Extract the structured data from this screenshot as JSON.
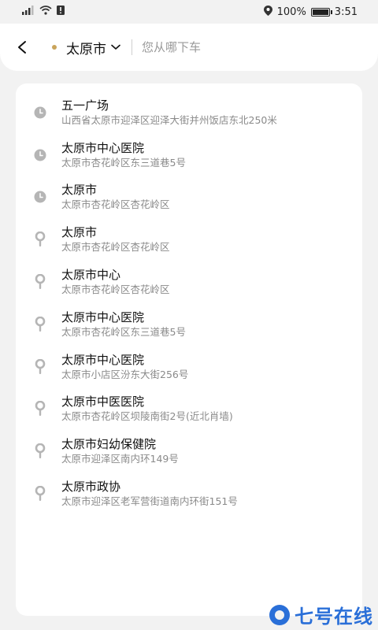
{
  "status_bar": {
    "battery_text": "100%",
    "time": "3:51"
  },
  "header": {
    "city": "太原市",
    "search_placeholder": "您从哪下车"
  },
  "results": [
    {
      "icon": "clock-icon",
      "name": "五一广场",
      "address": "山西省太原市迎泽区迎泽大街并州饭店东北250米"
    },
    {
      "icon": "clock-icon",
      "name": "太原市中心医院",
      "address": "太原市杏花岭区东三道巷5号"
    },
    {
      "icon": "clock-icon",
      "name": "太原市",
      "address": "太原市杏花岭区杏花岭区"
    },
    {
      "icon": "location-pin-icon",
      "name": "太原市",
      "address": "太原市杏花岭区杏花岭区"
    },
    {
      "icon": "location-pin-icon",
      "name": "太原市中心",
      "address": "太原市杏花岭区杏花岭区"
    },
    {
      "icon": "location-pin-icon",
      "name": "太原市中心医院",
      "address": "太原市杏花岭区东三道巷5号"
    },
    {
      "icon": "location-pin-icon",
      "name": "太原市中心医院",
      "address": "太原市小店区汾东大街256号"
    },
    {
      "icon": "location-pin-icon",
      "name": "太原市中医医院",
      "address": "太原市杏花岭区坝陵南街2号(近北肖墙)"
    },
    {
      "icon": "location-pin-icon",
      "name": "太原市妇幼保健院",
      "address": "太原市迎泽区南内环149号"
    },
    {
      "icon": "location-pin-icon",
      "name": "太原市政协",
      "address": "太原市迎泽区老军营街道南内环街151号"
    }
  ],
  "watermark": "七号在线",
  "colors": {
    "accent_dot": "#c9a45b",
    "icon_gray": "#b5b5b5",
    "watermark_blue": "#2a6fd8"
  }
}
